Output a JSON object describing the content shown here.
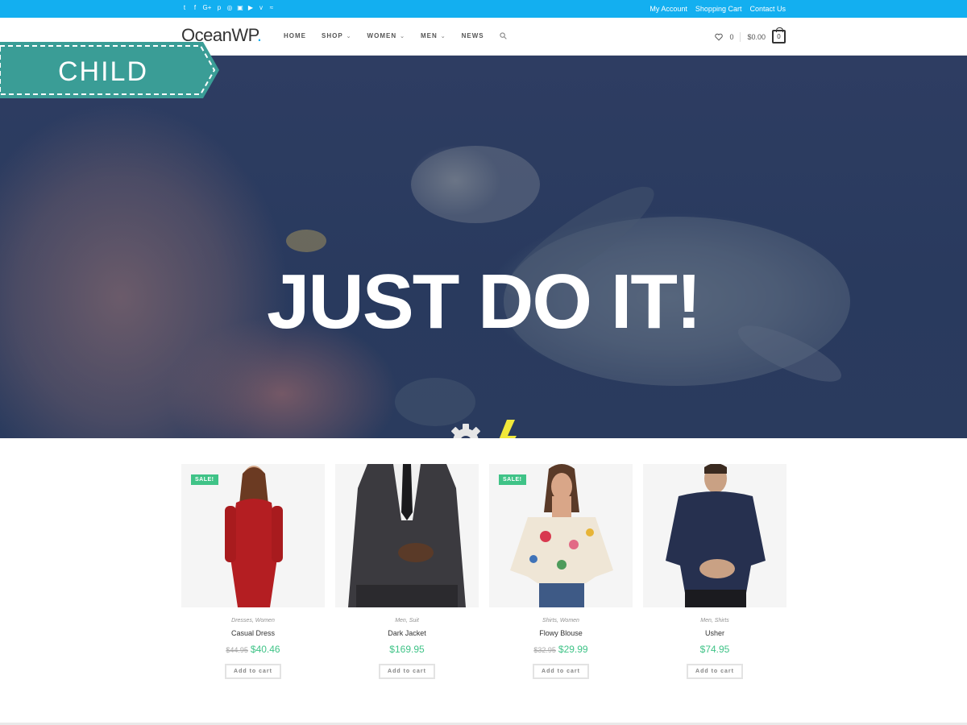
{
  "colors": {
    "accent": "#13aff0",
    "sale": "#3fc387",
    "ribbon": "#3a9d96"
  },
  "topbar": {
    "social_icons": [
      "twitter-icon",
      "facebook-icon",
      "google-plus-icon",
      "pinterest-icon",
      "dribbble-icon",
      "instagram-icon",
      "youtube-icon",
      "vimeo-icon",
      "rss-icon"
    ],
    "links": [
      "My Account",
      "Shopping Cart",
      "Contact Us"
    ]
  },
  "header": {
    "logo": "OceanWP",
    "logo_dot": ".",
    "nav": [
      {
        "label": "HOME",
        "dropdown": false
      },
      {
        "label": "SHOP",
        "dropdown": true
      },
      {
        "label": "WOMEN",
        "dropdown": true
      },
      {
        "label": "MEN",
        "dropdown": true
      },
      {
        "label": "NEWS",
        "dropdown": false
      }
    ],
    "wishlist_count": "0",
    "cart_total": "$0.00",
    "cart_count": "0"
  },
  "ribbon": {
    "label": "CHILD"
  },
  "hero": {
    "title": "JUST DO IT!",
    "icons": [
      "gear-icon",
      "lightning-icon"
    ]
  },
  "products": [
    {
      "sale_badge": "SALE!",
      "categories": "Dresses, Women",
      "name": "Casual Dress",
      "old_price": "$44.95",
      "price": "$40.46",
      "button": "Add to cart"
    },
    {
      "sale_badge": "",
      "categories": "Men, Suit",
      "name": "Dark Jacket",
      "old_price": "",
      "price": "$169.95",
      "button": "Add to cart"
    },
    {
      "sale_badge": "SALE!",
      "categories": "Shirts, Women",
      "name": "Flowy Blouse",
      "old_price": "$32.95",
      "price": "$29.99",
      "button": "Add to cart"
    },
    {
      "sale_badge": "",
      "categories": "Men, Shirts",
      "name": "Usher",
      "old_price": "",
      "price": "$74.95",
      "button": "Add to cart"
    }
  ]
}
